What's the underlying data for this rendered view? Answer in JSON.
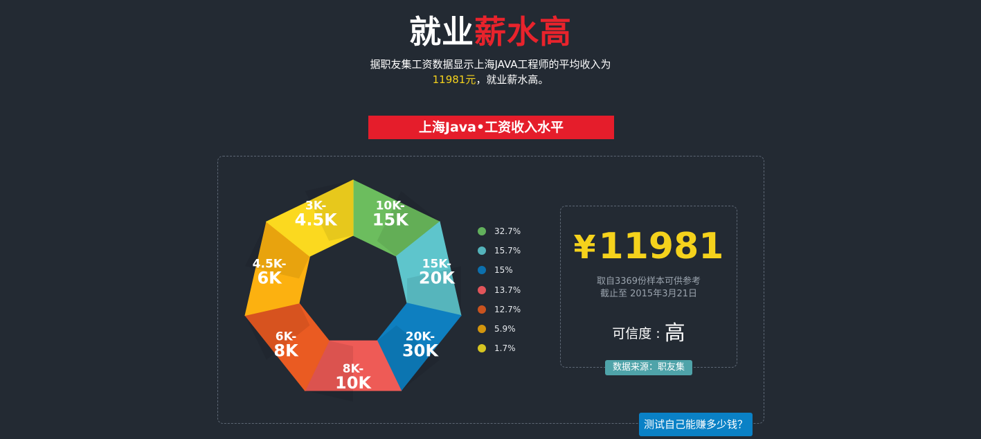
{
  "header": {
    "title_white": "就业",
    "title_red": "薪水高",
    "subtitle_line1": "据职友集工资数据显示上海JAVA工程师的平均收入为",
    "subtitle_amount": "11981元",
    "subtitle_line2_rest": "，就业薪水高。"
  },
  "banner": {
    "label": "上海Java•工资收入水平"
  },
  "summary": {
    "currency": "¥",
    "average_salary": "11981",
    "sample_note": "取自3369份样本可供参考",
    "date_note": "截止至 2015年3月21日",
    "credibility_label": "可信度 : ",
    "credibility_level": "高",
    "source_label": "数据来源：职友集"
  },
  "test_button": {
    "label": "测试自己能赚多少钱？"
  },
  "chart_data": {
    "type": "pie",
    "style": "heptagon-ring",
    "categories": [
      "10K-15K",
      "15K-20K",
      "20K-30K",
      "8K-10K",
      "6K-8K",
      "4.5K-6K",
      "3K-4.5K"
    ],
    "segment_labels": [
      {
        "top": "10K-",
        "bottom": "15K"
      },
      {
        "top": "15K-",
        "bottom": "20K"
      },
      {
        "top": "20K-",
        "bottom": "30K"
      },
      {
        "top": "8K-",
        "bottom": "10K"
      },
      {
        "top": "6K-",
        "bottom": "8K"
      },
      {
        "top": "4.5K-",
        "bottom": "6K"
      },
      {
        "top": "3K-",
        "bottom": "4.5K"
      }
    ],
    "segment_colors": [
      "#6cbd5e",
      "#5ec5cc",
      "#0e7fc0",
      "#ee5b56",
      "#ea5b22",
      "#fcb110",
      "#fbd91f"
    ],
    "legend": [
      {
        "label": "32.7%",
        "value": 32.7,
        "color": "#62b05c"
      },
      {
        "label": "15.7%",
        "value": 15.7,
        "color": "#54b3bb"
      },
      {
        "label": "15%",
        "value": 15.0,
        "color": "#0c70ad"
      },
      {
        "label": "13.7%",
        "value": 13.7,
        "color": "#e1555a"
      },
      {
        "label": "12.7%",
        "value": 12.7,
        "color": "#c9531f"
      },
      {
        "label": "5.9%",
        "value": 5.9,
        "color": "#d3960e"
      },
      {
        "label": "1.7%",
        "value": 1.7,
        "color": "#d7c521"
      }
    ]
  }
}
